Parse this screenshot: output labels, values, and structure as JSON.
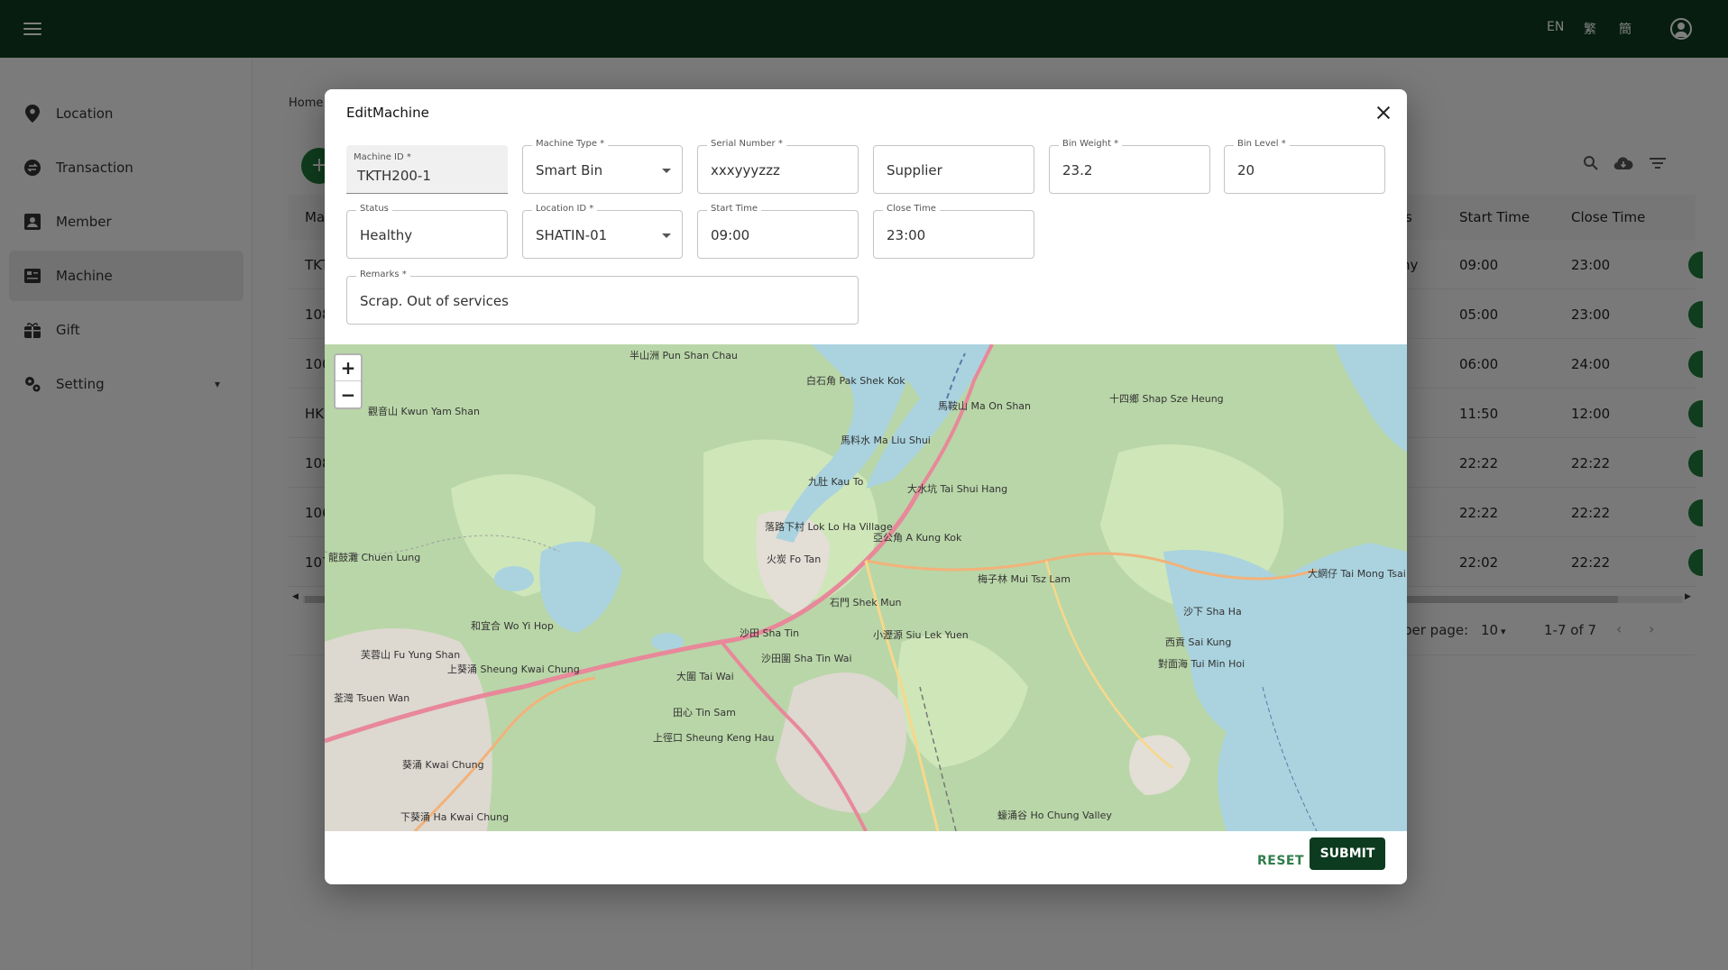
{
  "header": {
    "languages": [
      "EN",
      "繁",
      "簡"
    ]
  },
  "sidebar": {
    "items": [
      {
        "label": "Location",
        "icon": "location-pin-icon"
      },
      {
        "label": "Transaction",
        "icon": "transaction-icon"
      },
      {
        "label": "Member",
        "icon": "member-icon"
      },
      {
        "label": "Machine",
        "icon": "machine-icon",
        "active": true
      },
      {
        "label": "Gift",
        "icon": "gift-icon"
      },
      {
        "label": "Setting",
        "icon": "settings-icon",
        "expandable": true
      }
    ]
  },
  "page": {
    "breadcrumb": "Home"
  },
  "table": {
    "headers": {
      "col1": "Ma",
      "status": "s",
      "start_time": "Start Time",
      "close_time": "Close Time"
    },
    "rows": [
      {
        "id": "TKT",
        "status": "hy",
        "start": "09:00",
        "close": "23:00"
      },
      {
        "id": "108",
        "status": "",
        "start": "05:00",
        "close": "23:00"
      },
      {
        "id": "100",
        "status": "",
        "start": "06:00",
        "close": "24:00"
      },
      {
        "id": "HK",
        "status": "",
        "start": "11:50",
        "close": "12:00"
      },
      {
        "id": "108",
        "status": "",
        "start": "22:22",
        "close": "22:22"
      },
      {
        "id": "106",
        "status": "",
        "start": "22:22",
        "close": "22:22"
      },
      {
        "id": "107",
        "status": "",
        "start": "22:02",
        "close": "22:22"
      }
    ]
  },
  "pagination": {
    "rows_per_page_label": "per page:",
    "rows_per_page": "10",
    "range": "1-7 of 7"
  },
  "dialog": {
    "title": "EditMachine",
    "fields": {
      "machine_id": {
        "label": "Machine ID *",
        "value": "TKTH200-1"
      },
      "machine_type": {
        "label": "Machine Type *",
        "value": "Smart Bin"
      },
      "serial_number": {
        "label": "Serial Number *",
        "value": "xxxyyyzzz"
      },
      "supplier": {
        "label": "",
        "value": "Supplier"
      },
      "bin_weight": {
        "label": "Bin Weight *",
        "value": "23.2"
      },
      "bin_level": {
        "label": "Bin Level *",
        "value": "20"
      },
      "status": {
        "label": "Status",
        "value": "Healthy"
      },
      "location_id": {
        "label": "Location ID *",
        "value": "SHATIN-01"
      },
      "start_time": {
        "label": "Start Time",
        "value": "09:00"
      },
      "close_time": {
        "label": "Close Time",
        "value": "23:00"
      },
      "remarks": {
        "label": "Remarks *",
        "value": "Scrap. Out of services"
      }
    },
    "map": {
      "zoom_in": "+",
      "zoom_out": "−",
      "labels": [
        "半山洲 Pun Shan Chau",
        "白石角 Pak Shek Kok",
        "馬鞍山 Ma On Shan",
        "十四鄉 Shap Sze Heung",
        "馬料水 Ma Liu Shui",
        "九肚 Kau To",
        "大水坑 Tai Shui Hang",
        "落路下村 Lok Lo Ha Village",
        "亞公角 A Kung Kok",
        "火炭 Fo Tan",
        "石門 Shek Mun",
        "梅子林 Mui Tsz Lam",
        "沙下 Sha Ha",
        "大網仔 Tai Mong Tsai",
        "沙田 Sha Tin",
        "小瀝源 Siu Lek Yuen",
        "西貢 Sai Kung",
        "對面海 Tui Min Hoi",
        "和宜合 Wo Yi Hop",
        "芙蓉山 Fu Yung Shan",
        "上葵涌 Sheung Kwai Chung",
        "荃灣 Tsuen Wan",
        "大圍 Tai Wai",
        "沙田圍 Sha Tin Wai",
        "田心 Tin Sam",
        "上徑口 Sheung Keng Hau",
        "葵涌 Kwai Chung",
        "下葵涌 Ha Kwai Chung",
        "蠔涌谷 Ho Chung Valley",
        "觀音山 Kwun Yam Shan",
        "龍鼓灘 Chuen Lung"
      ]
    },
    "actions": {
      "reset": "RESET",
      "submit": "SUBMIT"
    }
  },
  "colors": {
    "appbar": "#0d3b1f",
    "primary": "#1f7a3a",
    "map_land": "#b5d0a5",
    "map_water": "#aad3df"
  }
}
